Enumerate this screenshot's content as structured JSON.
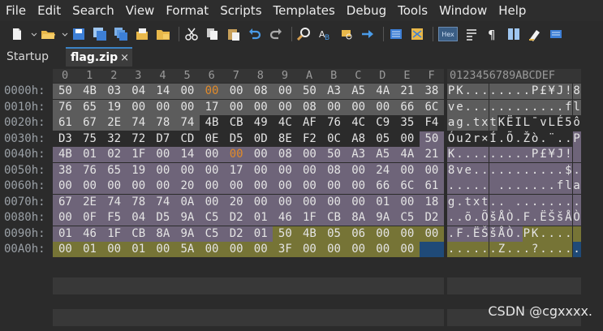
{
  "menu": [
    "File",
    "Edit",
    "Search",
    "View",
    "Format",
    "Scripts",
    "Templates",
    "Debug",
    "Tools",
    "Window",
    "Help"
  ],
  "toolbar": {
    "icons": [
      "new-file-icon",
      "open-folder-icon",
      "save-icon",
      "save-as-icon",
      "save-all-icon",
      "open-recent-icon",
      "folder-icon",
      "cut-icon",
      "copy-icon",
      "paste-icon",
      "undo-icon",
      "redo-icon",
      "find-icon",
      "replace-icon",
      "find-in-files-icon",
      "goto-icon",
      "compare-icon",
      "template-icon",
      "hex-icon",
      "word-wrap-icon",
      "paragraph-icon",
      "columns-icon",
      "highlight-icon",
      "settings-icon"
    ],
    "hex_label": "Hex"
  },
  "tabs": [
    {
      "label": "Startup",
      "active": false
    },
    {
      "label": "flag.zip",
      "active": true,
      "close": "×"
    }
  ],
  "hex": {
    "column_headers": [
      "0",
      "1",
      "2",
      "3",
      "4",
      "5",
      "6",
      "7",
      "8",
      "9",
      "A",
      "B",
      "C",
      "D",
      "E",
      "F"
    ],
    "ascii_header": "0123456789ABCDEF",
    "rows": [
      {
        "offset": "0000h:",
        "bytes": [
          "50",
          "4B",
          "03",
          "04",
          "14",
          "00",
          "00",
          "00",
          "08",
          "00",
          "50",
          "A3",
          "A5",
          "4A",
          "21",
          "38"
        ],
        "ascii": "PK........P£¥J!8"
      },
      {
        "offset": "0010h:",
        "bytes": [
          "76",
          "65",
          "19",
          "00",
          "00",
          "00",
          "17",
          "00",
          "00",
          "00",
          "08",
          "00",
          "00",
          "00",
          "66",
          "6C"
        ],
        "ascii": "ve............fl"
      },
      {
        "offset": "0020h:",
        "bytes": [
          "61",
          "67",
          "2E",
          "74",
          "78",
          "74",
          "4B",
          "CB",
          "49",
          "4C",
          "AF",
          "76",
          "4C",
          "C9",
          "35",
          "F4"
        ],
        "ascii": "ag.txtKËIL¯vLÉ5ô"
      },
      {
        "offset": "0030h:",
        "bytes": [
          "D3",
          "75",
          "32",
          "72",
          "D7",
          "CD",
          "0E",
          "D5",
          "0D",
          "8E",
          "F2",
          "0C",
          "A8",
          "05",
          "00",
          "50"
        ],
        "ascii": "Óu2r×Í.Õ.Žò.¨..P"
      },
      {
        "offset": "0040h:",
        "bytes": [
          "4B",
          "01",
          "02",
          "1F",
          "00",
          "14",
          "00",
          "00",
          "00",
          "08",
          "00",
          "50",
          "A3",
          "A5",
          "4A",
          "21"
        ],
        "ascii": "K.........P£¥J!"
      },
      {
        "offset": "0050h:",
        "bytes": [
          "38",
          "76",
          "65",
          "19",
          "00",
          "00",
          "00",
          "17",
          "00",
          "00",
          "00",
          "08",
          "00",
          "24",
          "00",
          "00"
        ],
        "ascii": "8ve...........$.."
      },
      {
        "offset": "0060h:",
        "bytes": [
          "00",
          "00",
          "00",
          "00",
          "00",
          "20",
          "00",
          "00",
          "00",
          "00",
          "00",
          "00",
          "00",
          "66",
          "6C",
          "61"
        ],
        "ascii": "..... .......fla"
      },
      {
        "offset": "0070h:",
        "bytes": [
          "67",
          "2E",
          "74",
          "78",
          "74",
          "0A",
          "00",
          "20",
          "00",
          "00",
          "00",
          "00",
          "00",
          "01",
          "00",
          "18"
        ],
        "ascii": "g.txt.. ........"
      },
      {
        "offset": "0080h:",
        "bytes": [
          "00",
          "0F",
          "F5",
          "04",
          "D5",
          "9A",
          "C5",
          "D2",
          "01",
          "46",
          "1F",
          "CB",
          "8A",
          "9A",
          "C5",
          "D2"
        ],
        "ascii": "..õ.ÕšÅÒ.F.ËŠšÅÒ"
      },
      {
        "offset": "0090h:",
        "bytes": [
          "01",
          "46",
          "1F",
          "CB",
          "8A",
          "9A",
          "C5",
          "D2",
          "01",
          "50",
          "4B",
          "05",
          "06",
          "00",
          "00",
          "00"
        ],
        "ascii": ".F.ËŠšÅÒ.PK...."
      },
      {
        "offset": "00A0h:",
        "bytes": [
          "00",
          "01",
          "00",
          "01",
          "00",
          "5A",
          "00",
          "00",
          "00",
          "3F",
          "00",
          "00",
          "00",
          "00",
          "00",
          ""
        ],
        "ascii": "......Z...?....."
      }
    ]
  },
  "colors": {
    "gray": "#5c5c5c",
    "violet": "#6e6479",
    "olive": "#767436",
    "blue": "#1f4a78",
    "orange_text": "#e08a2a"
  },
  "watermark": "CSDN @cgxxxx."
}
